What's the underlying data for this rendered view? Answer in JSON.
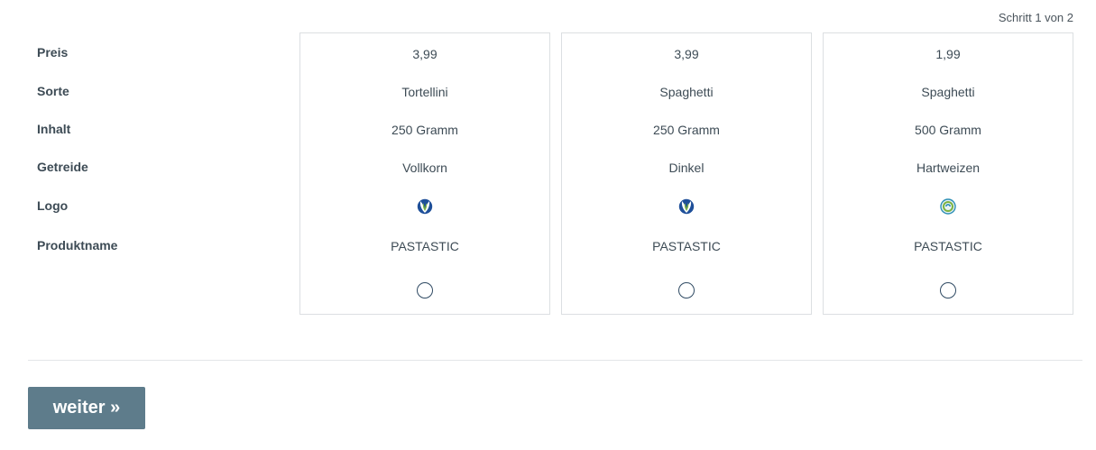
{
  "step_indicator": "Schritt 1 von 2",
  "row_labels": {
    "price": "Preis",
    "type": "Sorte",
    "content": "Inhalt",
    "grain": "Getreide",
    "logo": "Logo",
    "product_name": "Produktname"
  },
  "options": [
    {
      "price": "3,99",
      "type": "Tortellini",
      "content": "250 Gramm",
      "grain": "Vollkorn",
      "logo_icon": "green-leaf-blue-badge-logo-icon",
      "product_name": "PASTASTIC",
      "selected": false
    },
    {
      "price": "3,99",
      "type": "Spaghetti",
      "content": "250 Gramm",
      "grain": "Dinkel",
      "logo_icon": "green-leaf-blue-badge-logo-icon",
      "product_name": "PASTASTIC",
      "selected": false
    },
    {
      "price": "1,99",
      "type": "Spaghetti",
      "content": "500 Gramm",
      "grain": "Hartweizen",
      "logo_icon": "green-blue-swirl-logo-icon",
      "product_name": "PASTASTIC",
      "selected": false
    }
  ],
  "next_button": {
    "label": "weiter »",
    "color": "#5e7c8b"
  }
}
